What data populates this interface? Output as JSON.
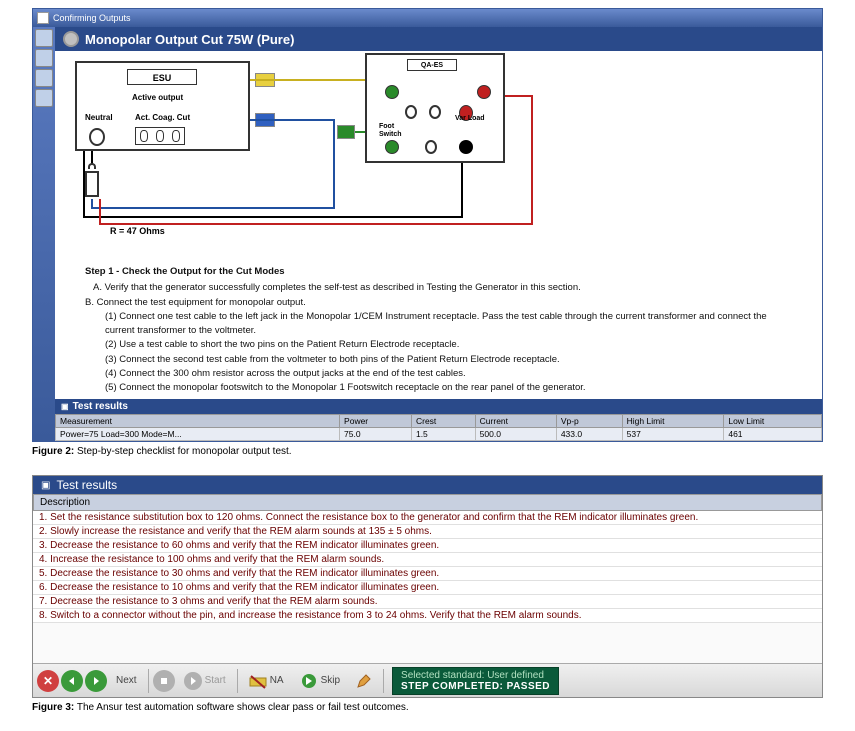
{
  "figure2": {
    "window_title": "Confirming Outputs",
    "header": "Monopolar Output Cut 75W (Pure)",
    "esu_label": "ESU",
    "active_output": "Active output",
    "neutral": "Neutral",
    "act_coag_cut": "Act. Coag. Cut",
    "qaes_label": "QA-ES",
    "foot_switch": "Foot\nSwitch",
    "var_load": "Var Load",
    "r_label": "R = 47 Ohms",
    "step_title": "Step 1 - Check the Output for the Cut Modes",
    "step_a": "A. Verify that the generator successfully completes the self-test as described in Testing the Generator in this section.",
    "step_b": "B. Connect the test equipment for monopolar output.",
    "step_b1": "(1) Connect one test cable to the left jack in the Monopolar 1/CEM Instrument receptacle. Pass the test cable through the current transformer and connect the current transformer to the voltmeter.",
    "step_b2": "(2) Use a test cable to short the two pins on the Patient Return Electrode receptacle.",
    "step_b3": "(3) Connect the second test cable from the voltmeter to both pins of the Patient Return Electrode receptacle.",
    "step_b4": "(4) Connect the 300 ohm resistor across the output jacks at the end of the test cables.",
    "step_b5": "(5) Connect the monopolar footswitch to the Monopolar 1 Footswitch receptacle on the rear panel of the generator.",
    "results_title": "Test results",
    "columns": [
      "Measurement",
      "Power",
      "Crest",
      "Current",
      "Vp-p",
      "High Limit",
      "Low Limit"
    ],
    "row": [
      "Power=75 Load=300 Mode=M...",
      "75.0",
      "1.5",
      "500.0",
      "433.0",
      "537",
      "461"
    ],
    "caption_label": "Figure 2:",
    "caption_text": " Step-by-step checklist for monopolar output test."
  },
  "figure3": {
    "results_title": "Test results",
    "desc_header": "Description",
    "rows": [
      "1. Set the resistance substitution box to 120 ohms. Connect the resistance box to the generator and confirm that the REM indicator illuminates green.",
      "2. Slowly increase the resistance and verify that the REM alarm sounds at 135 ± 5 ohms.",
      "3. Decrease the resistance to 60 ohms and verify that the REM indicator illuminates green.",
      "4. Increase the resistance to 100 ohms and verify that the REM alarm sounds.",
      "5. Decrease the resistance to 30 ohms and verify that the REM indicator illuminates green.",
      "6. Decrease the resistance to 10 ohms and verify that the REM indicator illuminates green.",
      "7. Decrease the resistance to 3 ohms and verify that the REM alarm sounds.",
      "8. Switch to a connector without the pin, and increase the resistance from 3 to 24 ohms. Verify that the REM alarm sounds."
    ],
    "toolbar": {
      "next": "Next",
      "start": "Start",
      "na": "NA",
      "skip": "Skip"
    },
    "status_line1": "Selected standard: User defined",
    "status_line2": "STEP COMPLETED:  PASSED",
    "caption_label": "Figure 3:",
    "caption_text": " The Ansur test automation software shows clear pass or fail test outcomes."
  }
}
